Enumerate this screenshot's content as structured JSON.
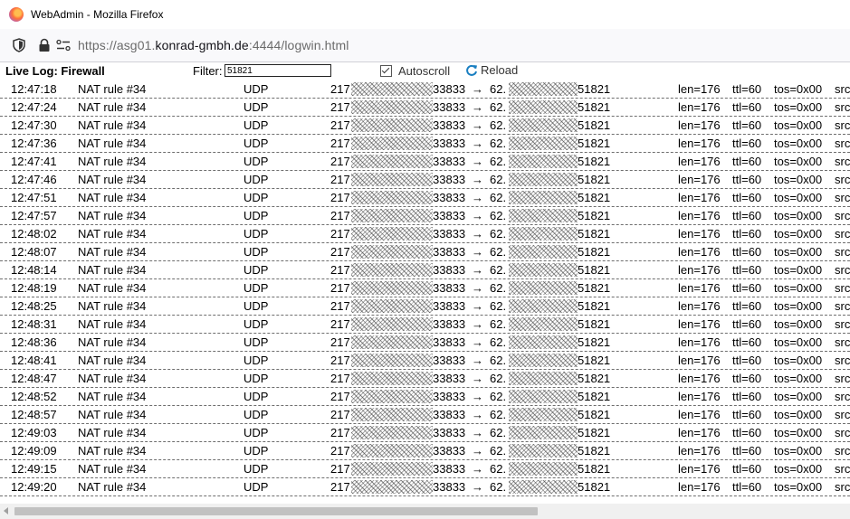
{
  "window": {
    "title": "WebAdmin - Mozilla Firefox"
  },
  "urlbar": {
    "scheme": "https://asg01.",
    "host": "konrad-gmbh.de",
    "rest": ":4444/logwin.html"
  },
  "log": {
    "title": "Live Log: Firewall",
    "filter_label": "Filter:",
    "filter_value": "51821",
    "autoscroll_label": "Autoscroll",
    "autoscroll_checked": true,
    "reload_label": "Reload"
  },
  "rows": [
    {
      "time": "12:47:18",
      "rule": "NAT rule #34",
      "proto": "UDP",
      "src_prefix": "217",
      "src_port": "33833",
      "arrow": "→",
      "dst_prefix": "62.",
      "dst_port": "51821",
      "len": "len=176",
      "ttl": "ttl=60",
      "tos": "tos=0x00",
      "more": "src"
    },
    {
      "time": "12:47:24",
      "rule": "NAT rule #34",
      "proto": "UDP",
      "src_prefix": "217",
      "src_port": "33833",
      "arrow": "→",
      "dst_prefix": "62.",
      "dst_port": "51821",
      "len": "len=176",
      "ttl": "ttl=60",
      "tos": "tos=0x00",
      "more": "src"
    },
    {
      "time": "12:47:30",
      "rule": "NAT rule #34",
      "proto": "UDP",
      "src_prefix": "217",
      "src_port": "33833",
      "arrow": "→",
      "dst_prefix": "62.",
      "dst_port": "51821",
      "len": "len=176",
      "ttl": "ttl=60",
      "tos": "tos=0x00",
      "more": "src"
    },
    {
      "time": "12:47:36",
      "rule": "NAT rule #34",
      "proto": "UDP",
      "src_prefix": "217",
      "src_port": "33833",
      "arrow": "→",
      "dst_prefix": "62.",
      "dst_port": "51821",
      "len": "len=176",
      "ttl": "ttl=60",
      "tos": "tos=0x00",
      "more": "src"
    },
    {
      "time": "12:47:41",
      "rule": "NAT rule #34",
      "proto": "UDP",
      "src_prefix": "217",
      "src_port": "33833",
      "arrow": "→",
      "dst_prefix": "62.",
      "dst_port": "51821",
      "len": "len=176",
      "ttl": "ttl=60",
      "tos": "tos=0x00",
      "more": "src"
    },
    {
      "time": "12:47:46",
      "rule": "NAT rule #34",
      "proto": "UDP",
      "src_prefix": "217",
      "src_port": "33833",
      "arrow": "→",
      "dst_prefix": "62.",
      "dst_port": "51821",
      "len": "len=176",
      "ttl": "ttl=60",
      "tos": "tos=0x00",
      "more": "src"
    },
    {
      "time": "12:47:51",
      "rule": "NAT rule #34",
      "proto": "UDP",
      "src_prefix": "217",
      "src_port": "33833",
      "arrow": "→",
      "dst_prefix": "62.",
      "dst_port": "51821",
      "len": "len=176",
      "ttl": "ttl=60",
      "tos": "tos=0x00",
      "more": "src"
    },
    {
      "time": "12:47:57",
      "rule": "NAT rule #34",
      "proto": "UDP",
      "src_prefix": "217",
      "src_port": "33833",
      "arrow": "→",
      "dst_prefix": "62.",
      "dst_port": "51821",
      "len": "len=176",
      "ttl": "ttl=60",
      "tos": "tos=0x00",
      "more": "src"
    },
    {
      "time": "12:48:02",
      "rule": "NAT rule #34",
      "proto": "UDP",
      "src_prefix": "217",
      "src_port": "33833",
      "arrow": "→",
      "dst_prefix": "62.",
      "dst_port": "51821",
      "len": "len=176",
      "ttl": "ttl=60",
      "tos": "tos=0x00",
      "more": "src"
    },
    {
      "time": "12:48:07",
      "rule": "NAT rule #34",
      "proto": "UDP",
      "src_prefix": "217",
      "src_port": "33833",
      "arrow": "→",
      "dst_prefix": "62.",
      "dst_port": "51821",
      "len": "len=176",
      "ttl": "ttl=60",
      "tos": "tos=0x00",
      "more": "src"
    },
    {
      "time": "12:48:14",
      "rule": "NAT rule #34",
      "proto": "UDP",
      "src_prefix": "217",
      "src_port": "33833",
      "arrow": "→",
      "dst_prefix": "62.",
      "dst_port": "51821",
      "len": "len=176",
      "ttl": "ttl=60",
      "tos": "tos=0x00",
      "more": "src"
    },
    {
      "time": "12:48:19",
      "rule": "NAT rule #34",
      "proto": "UDP",
      "src_prefix": "217",
      "src_port": "33833",
      "arrow": "→",
      "dst_prefix": "62.",
      "dst_port": "51821",
      "len": "len=176",
      "ttl": "ttl=60",
      "tos": "tos=0x00",
      "more": "src"
    },
    {
      "time": "12:48:25",
      "rule": "NAT rule #34",
      "proto": "UDP",
      "src_prefix": "217",
      "src_port": "33833",
      "arrow": "→",
      "dst_prefix": "62.",
      "dst_port": "51821",
      "len": "len=176",
      "ttl": "ttl=60",
      "tos": "tos=0x00",
      "more": "src"
    },
    {
      "time": "12:48:31",
      "rule": "NAT rule #34",
      "proto": "UDP",
      "src_prefix": "217",
      "src_port": "33833",
      "arrow": "→",
      "dst_prefix": "62.",
      "dst_port": "51821",
      "len": "len=176",
      "ttl": "ttl=60",
      "tos": "tos=0x00",
      "more": "src"
    },
    {
      "time": "12:48:36",
      "rule": "NAT rule #34",
      "proto": "UDP",
      "src_prefix": "217",
      "src_port": "33833",
      "arrow": "→",
      "dst_prefix": "62.",
      "dst_port": "51821",
      "len": "len=176",
      "ttl": "ttl=60",
      "tos": "tos=0x00",
      "more": "src"
    },
    {
      "time": "12:48:41",
      "rule": "NAT rule #34",
      "proto": "UDP",
      "src_prefix": "217",
      "src_port": "33833",
      "arrow": "→",
      "dst_prefix": "62.",
      "dst_port": "51821",
      "len": "len=176",
      "ttl": "ttl=60",
      "tos": "tos=0x00",
      "more": "src"
    },
    {
      "time": "12:48:47",
      "rule": "NAT rule #34",
      "proto": "UDP",
      "src_prefix": "217",
      "src_port": "33833",
      "arrow": "→",
      "dst_prefix": "62.",
      "dst_port": "51821",
      "len": "len=176",
      "ttl": "ttl=60",
      "tos": "tos=0x00",
      "more": "src"
    },
    {
      "time": "12:48:52",
      "rule": "NAT rule #34",
      "proto": "UDP",
      "src_prefix": "217",
      "src_port": "33833",
      "arrow": "→",
      "dst_prefix": "62.",
      "dst_port": "51821",
      "len": "len=176",
      "ttl": "ttl=60",
      "tos": "tos=0x00",
      "more": "src"
    },
    {
      "time": "12:48:57",
      "rule": "NAT rule #34",
      "proto": "UDP",
      "src_prefix": "217",
      "src_port": "33833",
      "arrow": "→",
      "dst_prefix": "62.",
      "dst_port": "51821",
      "len": "len=176",
      "ttl": "ttl=60",
      "tos": "tos=0x00",
      "more": "src"
    },
    {
      "time": "12:49:03",
      "rule": "NAT rule #34",
      "proto": "UDP",
      "src_prefix": "217",
      "src_port": "33833",
      "arrow": "→",
      "dst_prefix": "62.",
      "dst_port": "51821",
      "len": "len=176",
      "ttl": "ttl=60",
      "tos": "tos=0x00",
      "more": "src"
    },
    {
      "time": "12:49:09",
      "rule": "NAT rule #34",
      "proto": "UDP",
      "src_prefix": "217",
      "src_port": "33833",
      "arrow": "→",
      "dst_prefix": "62.",
      "dst_port": "51821",
      "len": "len=176",
      "ttl": "ttl=60",
      "tos": "tos=0x00",
      "more": "src"
    },
    {
      "time": "12:49:15",
      "rule": "NAT rule #34",
      "proto": "UDP",
      "src_prefix": "217",
      "src_port": "33833",
      "arrow": "→",
      "dst_prefix": "62.",
      "dst_port": "51821",
      "len": "len=176",
      "ttl": "ttl=60",
      "tos": "tos=0x00",
      "more": "src"
    },
    {
      "time": "12:49:20",
      "rule": "NAT rule #34",
      "proto": "UDP",
      "src_prefix": "217",
      "src_port": "33833",
      "arrow": "→",
      "dst_prefix": "62.",
      "dst_port": "51821",
      "len": "len=176",
      "ttl": "ttl=60",
      "tos": "tos=0x00",
      "more": "src"
    }
  ],
  "icons": {
    "browser": "firefox-icon",
    "tracking": "shield-icon",
    "security": "lock-icon",
    "permissions": "permissions-icon",
    "reload": "reload-icon"
  },
  "colors": {
    "reload_icon": "#1a7fc1",
    "url_host": "#15141a",
    "url_dim": "#6b6b6b"
  }
}
